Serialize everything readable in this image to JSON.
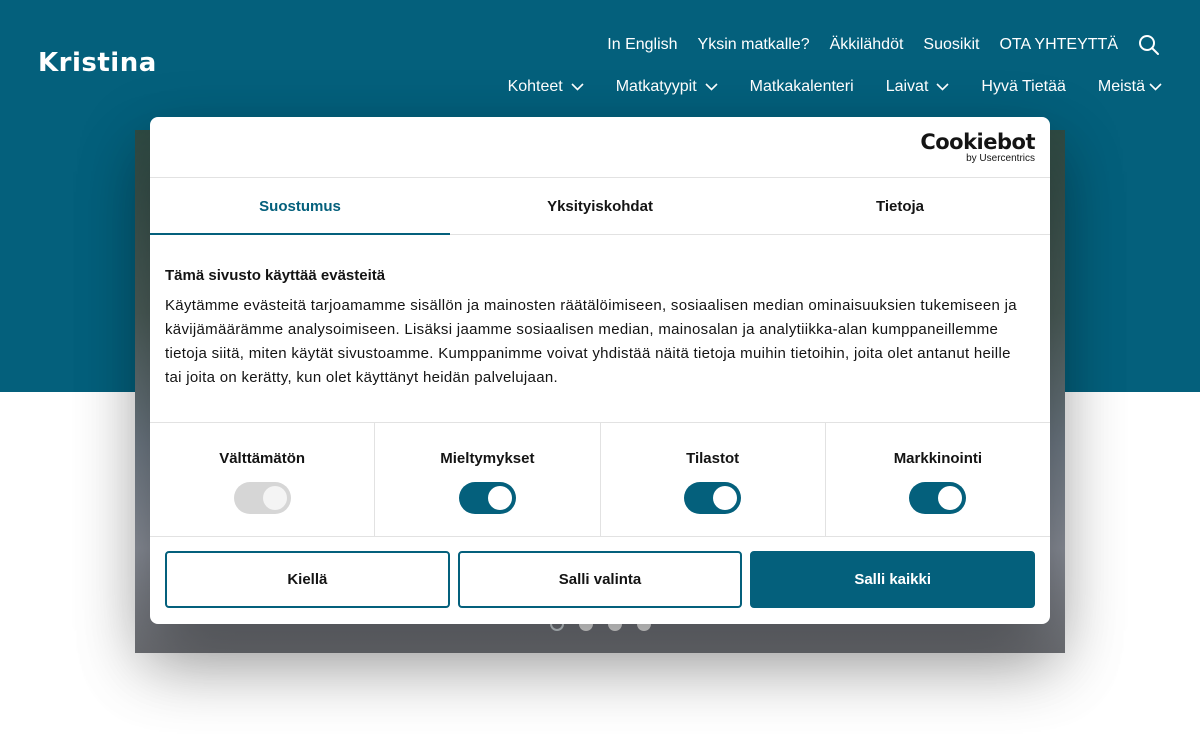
{
  "site": {
    "logo": "Kristina",
    "top_links": [
      "In English",
      "Yksin matkalle?",
      "Äkkilähdöt",
      "Suosikit",
      "OTA YHTEYTTÄ"
    ],
    "main_nav": [
      {
        "label": "Kohteet",
        "dropdown": true
      },
      {
        "label": "Matkatyypit",
        "dropdown": true
      },
      {
        "label": "Matkakalenteri",
        "dropdown": false
      },
      {
        "label": "Laivat",
        "dropdown": true
      },
      {
        "label": "Hyvä Tietää",
        "dropdown": false
      },
      {
        "label": "Meistä",
        "dropdown": true
      }
    ],
    "search_icon": "search-icon",
    "carousel_dots": 4,
    "carousel_active": 1
  },
  "cookie_dialog": {
    "brand": "Cookiebot",
    "brand_sub": "by Usercentrics",
    "tabs": [
      {
        "label": "Suostumus",
        "active": true
      },
      {
        "label": "Yksityiskohdat",
        "active": false
      },
      {
        "label": "Tietoja",
        "active": false
      }
    ],
    "heading": "Tämä sivusto käyttää evästeitä",
    "body": "Käytämme evästeitä tarjoamamme sisällön ja mainosten räätälöimiseen, sosiaalisen median ominaisuuksien tukemiseen ja kävijämäärämme analysoimiseen. Lisäksi jaamme sosiaalisen median, mainosalan ja analytiikka-alan kumppaneillemme tietoja siitä, miten käytät sivustoamme. Kumppanimme voivat yhdistää näitä tietoja muihin tietoihin, joita olet antanut heille tai joita on kerätty, kun olet käyttänyt heidän palvelujaan.",
    "toggles": [
      {
        "label": "Välttämätön",
        "on": false,
        "disabled": true
      },
      {
        "label": "Mieltymykset",
        "on": true,
        "disabled": false
      },
      {
        "label": "Tilastot",
        "on": true,
        "disabled": false
      },
      {
        "label": "Markkinointi",
        "on": true,
        "disabled": false
      }
    ],
    "buttons": {
      "deny": "Kiellä",
      "allow_selection": "Salli valinta",
      "allow_all": "Salli kaikki"
    }
  },
  "colors": {
    "brand": "#04607c",
    "text": "#141414",
    "toggle_off": "#d6d6d6"
  }
}
